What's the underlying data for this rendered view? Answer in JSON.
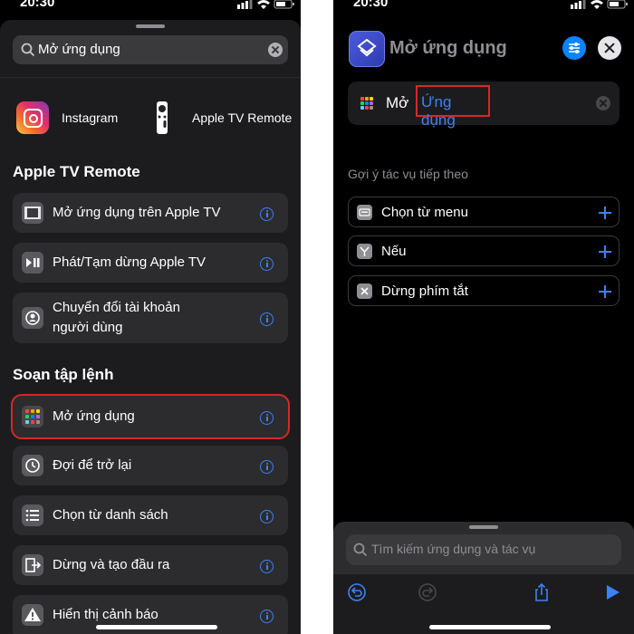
{
  "left": {
    "status_time": "20:30",
    "search_query": "Mở ứng dụng",
    "apps": [
      {
        "label": "Instagram",
        "icon": "instagram-icon"
      },
      {
        "label": "Apple TV Remote",
        "icon": "apple-tv-remote-icon"
      }
    ],
    "section1_title": "Apple TV Remote",
    "section1_items": [
      {
        "label": "Mở ứng dụng trên Apple TV",
        "icon": "tv-screen-icon"
      },
      {
        "label": "Phát/Tạm dừng Apple TV",
        "icon": "play-pause-icon"
      },
      {
        "label_line1": "Chuyển đổi tài khoản",
        "label_line2": "người dùng",
        "icon": "user-switch-icon"
      }
    ],
    "section2_title": "Soạn tập lệnh",
    "section2_items": [
      {
        "label": "Mở ứng dụng",
        "icon": "app-grid-icon",
        "highlighted": true
      },
      {
        "label": "Đợi để trở lại",
        "icon": "wait-clock-icon"
      },
      {
        "label": "Chọn từ danh sách",
        "icon": "list-icon"
      },
      {
        "label": "Dừng và tạo đầu ra",
        "icon": "exit-output-icon"
      },
      {
        "label": "Hiển thị cảnh báo",
        "icon": "warning-icon"
      }
    ]
  },
  "right": {
    "status_time": "20:30",
    "title": "Mở ứng dụng",
    "action_verb": "Mở",
    "action_param": "Ứng dụng",
    "suggestions_title": "Gợi ý tác vụ tiếp theo",
    "suggestions": [
      {
        "label": "Chọn từ menu",
        "icon": "menu-icon"
      },
      {
        "label": "Nếu",
        "icon": "branch-icon"
      },
      {
        "label": "Dừng phím tắt",
        "icon": "stop-x-icon"
      }
    ],
    "search_placeholder": "Tìm kiếm ứng dụng và tác vụ"
  },
  "colors": {
    "accent_blue": "#3b82f6",
    "highlight_red": "#d62828",
    "sheet_bg": "#1c1c1e",
    "cell_bg": "#2c2c2e"
  }
}
